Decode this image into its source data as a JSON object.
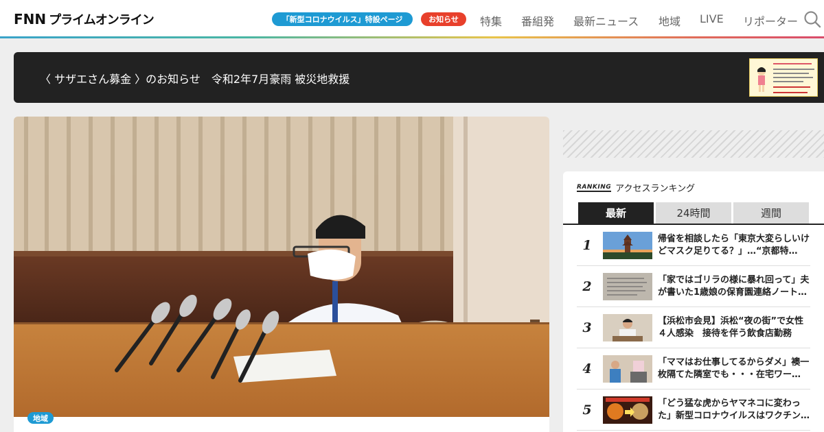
{
  "header": {
    "logo_fnn": "FNN",
    "logo_text": "プライムオンライン",
    "pill_corona": "「新型コロナウイルス」特設ページ",
    "pill_notice": "お知らせ",
    "nav": [
      "特集",
      "番組発",
      "最新ニュース",
      "地域",
      "LIVE",
      "リポーター"
    ],
    "search_icon": "search-icon"
  },
  "banner": {
    "part1": "〈 サザエさん募金 〉のお知らせ",
    "part2": "令和2年7月豪雨 被災地救援"
  },
  "article": {
    "tag": "地域"
  },
  "ranking": {
    "badge": "RANKING",
    "title": "アクセスランキング",
    "tabs": [
      "最新",
      "24時間",
      "週間"
    ],
    "active_tab": "最新",
    "items": [
      {
        "rank": "1",
        "title": "帰省を相談したら「東京大変らしいけどマスク足りてる？」…“京都特…"
      },
      {
        "rank": "2",
        "title": "「家ではゴリラの様に暴れ回って」夫が書いた1歳娘の保育園連絡ノート…"
      },
      {
        "rank": "3",
        "title": "【浜松市会見】浜松“夜の街”で女性４人感染　接待を伴う飲食店勤務"
      },
      {
        "rank": "4",
        "title": "「ママはお仕事してるからダメ」襖一枚隔てた隣室でも・・・在宅ワー…"
      },
      {
        "rank": "5",
        "title": "「どう猛な虎からヤマネコに変わった」新型コロナウイルスはワクチン…"
      }
    ]
  }
}
